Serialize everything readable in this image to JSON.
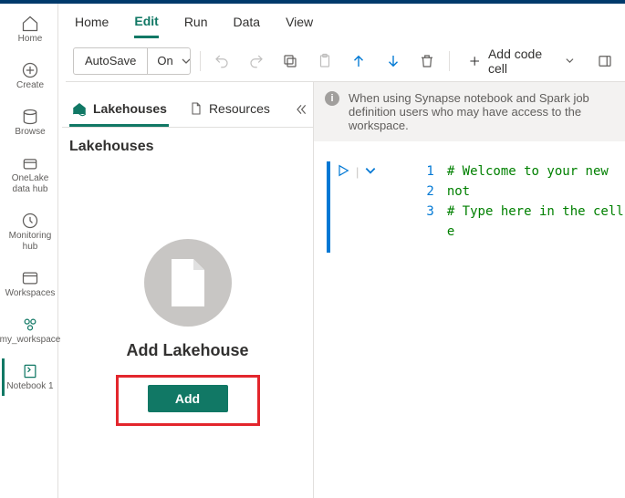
{
  "leftnav": {
    "items": [
      {
        "label": "Home"
      },
      {
        "label": "Create"
      },
      {
        "label": "Browse"
      },
      {
        "label": "OneLake data hub"
      },
      {
        "label": "Monitoring hub"
      },
      {
        "label": "Workspaces"
      },
      {
        "label": "my_workspace"
      },
      {
        "label": "Notebook 1"
      }
    ]
  },
  "tabs": {
    "items": [
      {
        "label": "Home"
      },
      {
        "label": "Edit"
      },
      {
        "label": "Run"
      },
      {
        "label": "Data"
      },
      {
        "label": "View"
      }
    ]
  },
  "toolbar": {
    "autosave_label": "AutoSave",
    "autosave_value": "On",
    "add_code_label": "Add code cell"
  },
  "sidepanel": {
    "tabs": [
      {
        "label": "Lakehouses"
      },
      {
        "label": "Resources"
      }
    ],
    "title": "Lakehouses",
    "empty_heading": "Add Lakehouse",
    "add_button": "Add"
  },
  "info_bar": {
    "text": "When using Synapse notebook and Spark job definition users who may have access to the workspace."
  },
  "code": {
    "line1": "# Welcome to your new not",
    "line2": "# Type here in the cell e",
    "lineNums": [
      "1",
      "2",
      "3"
    ]
  }
}
